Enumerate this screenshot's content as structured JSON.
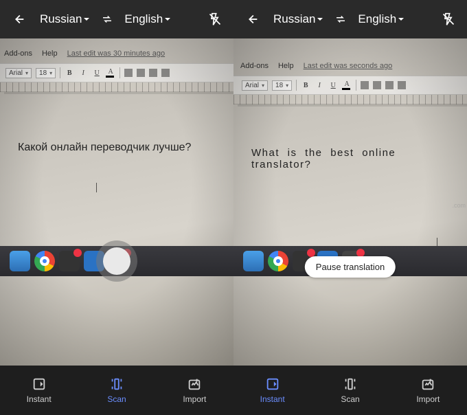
{
  "left": {
    "source_lang": "Russian",
    "target_lang": "English",
    "doc_menu": {
      "addons": "Add-ons",
      "help": "Help",
      "last_edit": "Last edit was 30 minutes ago"
    },
    "toolbar": {
      "font": "Arial",
      "size": "18"
    },
    "document_text": "Какой онлайн переводчик лучше?",
    "nav": {
      "instant": "Instant",
      "scan": "Scan",
      "import": "Import"
    },
    "active_tab": "scan"
  },
  "right": {
    "source_lang": "Russian",
    "target_lang": "English",
    "doc_menu": {
      "addons": "Add-ons",
      "help": "Help",
      "last_edit": "Last edit was seconds ago"
    },
    "toolbar": {
      "font": "Arial",
      "size": "18"
    },
    "document_text": "What is the best online translator?",
    "pause_label": "Pause translation",
    "nav": {
      "instant": "Instant",
      "scan": "Scan",
      "import": "Import"
    },
    "active_tab": "instant"
  },
  "watermark": ".com"
}
